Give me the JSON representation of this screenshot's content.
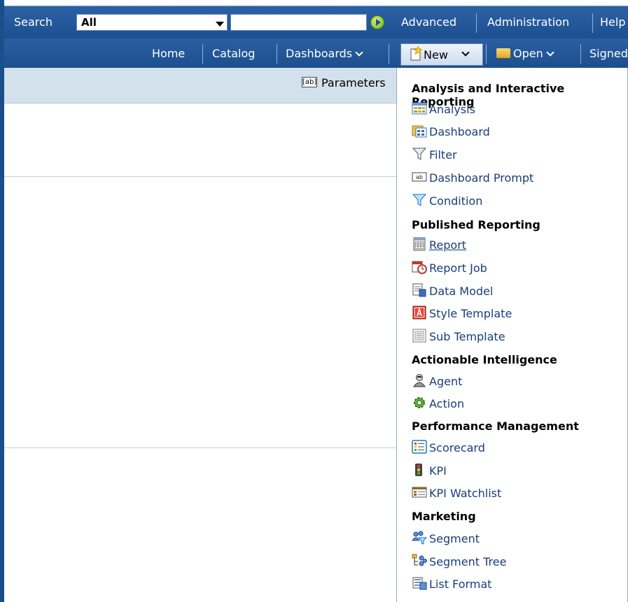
{
  "top_bar": {
    "search_label": "Search",
    "scope_value": "All",
    "search_placeholder": "",
    "advanced": "Advanced",
    "administration": "Administration",
    "help": "Help"
  },
  "nav_bar": {
    "home": "Home",
    "catalog": "Catalog",
    "dashboards": "Dashboards",
    "new": "New",
    "open": "Open",
    "signed": "Signed In As"
  },
  "toolbar": {
    "parameters": "Parameters",
    "parameters_icon_text": "[ab]"
  },
  "new_menu": {
    "sections": [
      {
        "header": "Analysis and Interactive Reporting",
        "items": [
          {
            "label": "Analysis",
            "icon": "analysis-icon"
          },
          {
            "label": "Dashboard",
            "icon": "dashboard-icon"
          },
          {
            "label": "Filter",
            "icon": "filter-icon"
          },
          {
            "label": "Dashboard Prompt",
            "icon": "prompt-icon"
          },
          {
            "label": "Condition",
            "icon": "condition-icon"
          }
        ]
      },
      {
        "header": "Published Reporting",
        "items": [
          {
            "label": "Report",
            "icon": "report-icon"
          },
          {
            "label": "Report Job",
            "icon": "report-job-icon"
          },
          {
            "label": "Data Model",
            "icon": "data-model-icon"
          },
          {
            "label": "Style Template",
            "icon": "style-template-icon"
          },
          {
            "label": "Sub Template",
            "icon": "sub-template-icon"
          }
        ]
      },
      {
        "header": "Actionable Intelligence",
        "items": [
          {
            "label": "Agent",
            "icon": "agent-icon"
          },
          {
            "label": "Action",
            "icon": "action-icon"
          }
        ]
      },
      {
        "header": "Performance Management",
        "items": [
          {
            "label": "Scorecard",
            "icon": "scorecard-icon"
          },
          {
            "label": "KPI",
            "icon": "kpi-icon"
          },
          {
            "label": "KPI Watchlist",
            "icon": "kpi-watchlist-icon"
          }
        ]
      },
      {
        "header": "Marketing",
        "items": [
          {
            "label": "Segment",
            "icon": "segment-icon"
          },
          {
            "label": "Segment Tree",
            "icon": "segment-tree-icon"
          },
          {
            "label": "List Format",
            "icon": "list-format-icon"
          }
        ]
      }
    ]
  }
}
